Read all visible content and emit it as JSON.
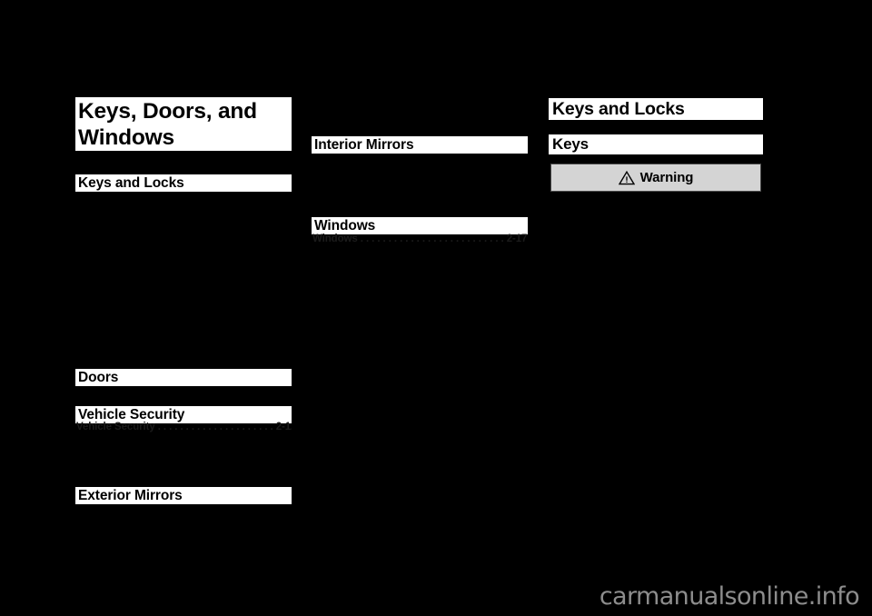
{
  "document": {
    "background_color": "#000000",
    "chapter_title": "Keys, Doors, and\nWindows"
  },
  "left_column": {
    "headings": [
      {
        "label": "Keys and Locks"
      },
      {
        "label": "Doors"
      },
      {
        "label": "Vehicle Security"
      },
      {
        "label": "Exterior Mirrors"
      }
    ],
    "ghost_entries": [
      {
        "label": "Vehicle Security . . . . . . . . . . . . . . . . . . . . . 2-12"
      }
    ]
  },
  "middle_column": {
    "headings": [
      {
        "label": "Interior Mirrors"
      },
      {
        "label": "Windows"
      }
    ],
    "ghost_entries": [
      {
        "label": "Windows . . . . . . . . . . . . . . . . . . . . . . . . . . 2-17"
      }
    ]
  },
  "right_column": {
    "page_heading": "Keys and Locks",
    "sub_heading": "Keys",
    "warning": {
      "icon": "warning-triangle-icon",
      "label": "Warning",
      "background_color": "#d4d4d4",
      "border_color": "#4a4a4a"
    }
  },
  "watermark": {
    "text": "carmanualsonline.info",
    "color": "#8d8d8d"
  }
}
